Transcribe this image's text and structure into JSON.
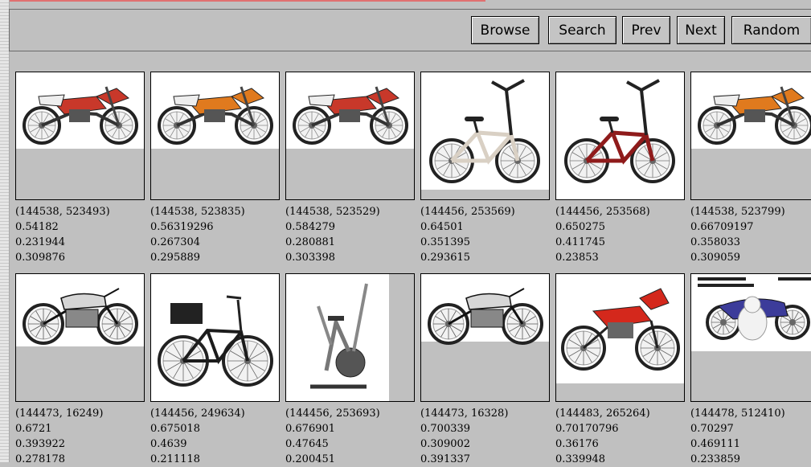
{
  "toolbar": {
    "buttons": [
      {
        "label": "Browse"
      },
      {
        "label": "Search"
      },
      {
        "label": "Prev"
      },
      {
        "label": "Next"
      },
      {
        "label": "Random"
      }
    ]
  },
  "results": [
    {
      "id": "(144538, 523493)",
      "v1": "0.54182",
      "v2": "0.231944",
      "v3": "0.309876",
      "subject": "red-white dirt bike"
    },
    {
      "id": "(144538, 523835)",
      "v1": "0.56319296",
      "v2": "0.267304",
      "v3": "0.295889",
      "subject": "orange dirt bike"
    },
    {
      "id": "(144538, 523529)",
      "v1": "0.584279",
      "v2": "0.280881",
      "v3": "0.303398",
      "subject": "red-white dirt bike"
    },
    {
      "id": "(144456, 253569)",
      "v1": "0.64501",
      "v2": "0.351395",
      "v3": "0.293615",
      "subject": "silver BMX bicycle"
    },
    {
      "id": "(144456, 253568)",
      "v1": "0.650275",
      "v2": "0.411745",
      "v3": "0.23853",
      "subject": "red BMX bicycle"
    },
    {
      "id": "(144538, 523799)",
      "v1": "0.66709197",
      "v2": "0.358033",
      "v3": "0.309059",
      "subject": "orange dirt bike"
    },
    {
      "id": "(144473, 16249)",
      "v1": "0.6721",
      "v2": "0.393922",
      "v3": "0.278178",
      "subject": "vintage motorcycle"
    },
    {
      "id": "(144456, 249634)",
      "v1": "0.675018",
      "v2": "0.4639",
      "v3": "0.211118",
      "subject": "touring bicycle"
    },
    {
      "id": "(144456, 253693)",
      "v1": "0.676901",
      "v2": "0.47645",
      "v3": "0.200451",
      "subject": "exercise bike"
    },
    {
      "id": "(144473, 16328)",
      "v1": "0.700339",
      "v2": "0.309002",
      "v3": "0.391337",
      "subject": "vintage motorcycle"
    },
    {
      "id": "(144483, 265264)",
      "v1": "0.70170796",
      "v2": "0.36176",
      "v3": "0.339948",
      "subject": "red enduro motorcycle"
    },
    {
      "id": "(144478, 512410)",
      "v1": "0.70297",
      "v2": "0.469111",
      "v3": "0.233859",
      "subject": "cruiser motorcycle with dog"
    }
  ]
}
